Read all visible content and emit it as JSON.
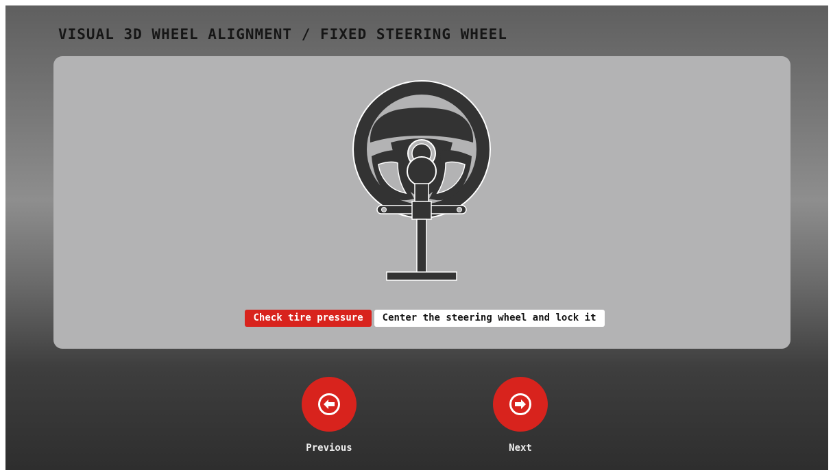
{
  "header": {
    "title": "VISUAL 3D WHEEL ALIGNMENT / FIXED STEERING WHEEL"
  },
  "illustration": {
    "icon": "steering-wheel-with-lock-icon"
  },
  "steps": [
    {
      "label": "Check tire pressure",
      "state": "active"
    },
    {
      "label": "Center the steering wheel and lock it",
      "state": "current"
    }
  ],
  "navigation": {
    "previous_label": "Previous",
    "next_label": "Next"
  },
  "colors": {
    "accent": "#d8231d",
    "panel": "#b3b3b4",
    "icon_dark": "#333333"
  }
}
